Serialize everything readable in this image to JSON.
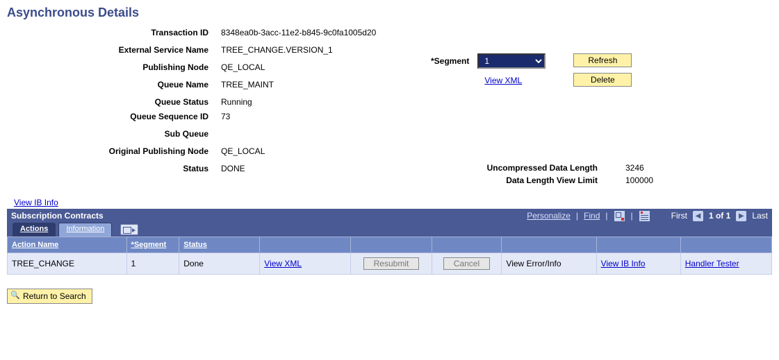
{
  "page_title": "Asynchronous Details",
  "fields": {
    "transaction_id": {
      "label": "Transaction ID",
      "value": "8348ea0b-3acc-11e2-b845-9c0fa1005d20"
    },
    "external_service_name": {
      "label": "External Service Name",
      "value": "TREE_CHANGE.VERSION_1"
    },
    "publishing_node": {
      "label": "Publishing Node",
      "value": "QE_LOCAL"
    },
    "queue_name": {
      "label": "Queue Name",
      "value": "TREE_MAINT"
    },
    "queue_status": {
      "label": "Queue Status",
      "value": "Running"
    },
    "queue_sequence_id": {
      "label": "Queue Sequence ID",
      "value": "73"
    },
    "sub_queue": {
      "label": "Sub Queue",
      "value": ""
    },
    "original_publishing_node": {
      "label": "Original Publishing Node",
      "value": "QE_LOCAL"
    },
    "status": {
      "label": "Status",
      "value": "DONE"
    }
  },
  "segment": {
    "label": "*Segment",
    "selected": "1",
    "view_xml": "View XML"
  },
  "buttons": {
    "refresh": "Refresh",
    "delete": "Delete",
    "return_to_search": "Return to Search"
  },
  "right_fields": {
    "uncompressed_data_length": {
      "label": "Uncompressed Data Length",
      "value": "3246"
    },
    "data_length_view_limit": {
      "label": "Data Length View Limit",
      "value": "100000"
    }
  },
  "links": {
    "view_ib_info": "View IB Info"
  },
  "grid": {
    "title": "Subscription Contracts",
    "toolbar": {
      "personalize": "Personalize",
      "find": "Find",
      "first": "First",
      "counter": "1 of 1",
      "last": "Last"
    },
    "tabs": {
      "actions": "Actions",
      "information": "Information"
    },
    "columns": {
      "action_name": "Action Name",
      "segment": "*Segment",
      "status": "Status"
    },
    "row": {
      "action_name": "TREE_CHANGE",
      "segment": "1",
      "status": "Done",
      "view_xml": "View XML",
      "resubmit": "Resubmit",
      "cancel": "Cancel",
      "view_error_info": "View Error/Info",
      "view_ib_info": "View IB Info",
      "handler_tester": "Handler Tester"
    }
  }
}
